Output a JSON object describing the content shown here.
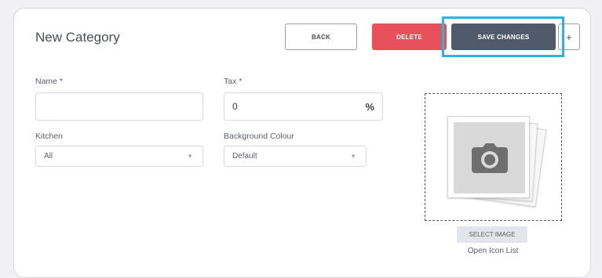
{
  "form": {
    "title": "New Category",
    "buttons": {
      "back": "BACK",
      "delete": "DELETE",
      "save": "SAVE CHANGES",
      "more": "+"
    },
    "fields": {
      "name": {
        "label": "Name *",
        "value": ""
      },
      "tax": {
        "label": "Tax *",
        "value": "0",
        "suffix": "%"
      },
      "kitchen": {
        "label": "Kitchen",
        "selected": "All"
      },
      "background": {
        "label": "Background Colour",
        "selected": "Default"
      }
    },
    "image": {
      "select_label": "SELECT IMAGE",
      "icon_list_link": "Open Icon List",
      "icon": "camera-icon"
    }
  },
  "colors": {
    "delete": "#e8505b",
    "save": "#4f5a6b",
    "highlight": "#22b8e0"
  }
}
